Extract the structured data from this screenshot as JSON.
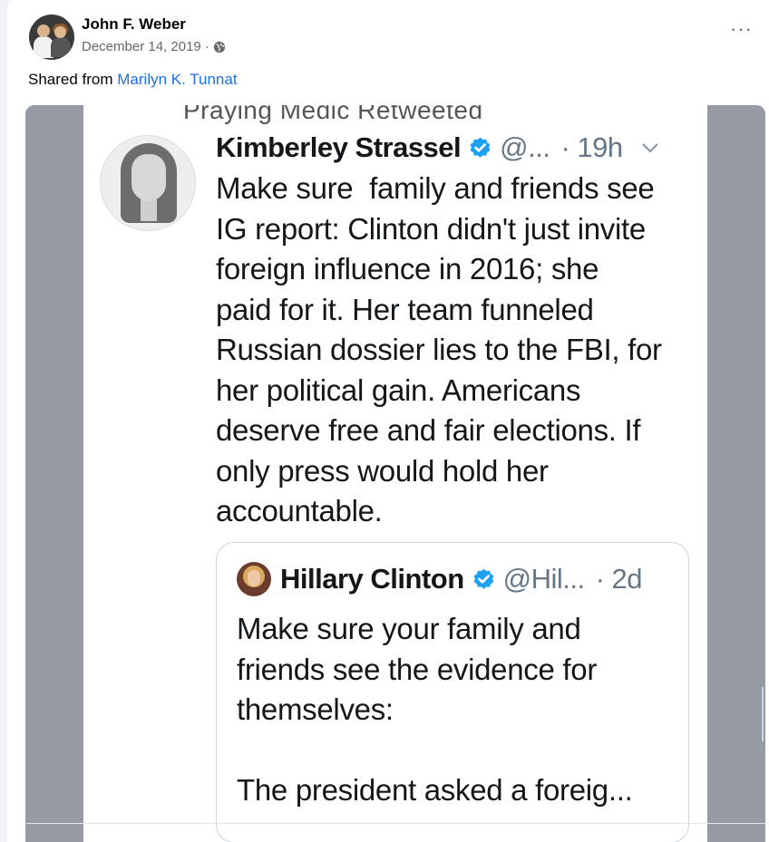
{
  "post": {
    "author": "John F. Weber",
    "date": "December 14, 2019 ·",
    "privacy_icon": "globe-icon",
    "shared_prefix": "Shared from ",
    "shared_from": "Marilyn K. Tunnat",
    "more_label": "···"
  },
  "tweet": {
    "retweet_context": "Praying Medic Retweeted",
    "author": "Kimberley Strassel",
    "handle": "@...",
    "time": "· 19h",
    "text": "Make sure  family and friends see\nIG report: Clinton didn't just invite\nforeign influence in 2016; she\npaid for it. Her team funneled\nRussian dossier lies to the FBI, for\nher political gain. Americans\ndeserve free and fair elections. If\nonly press would hold her\naccountable.",
    "verified_color": "#1da1f2"
  },
  "quoted_tweet": {
    "author": "Hillary Clinton",
    "handle": "@Hil...",
    "time": "· 2d",
    "text": "Make sure your family and\nfriends see the evidence for\nthemselves:\n\nThe president asked a foreig..."
  },
  "colors": {
    "link": "#216fdb",
    "media_background": "#969aa3"
  }
}
